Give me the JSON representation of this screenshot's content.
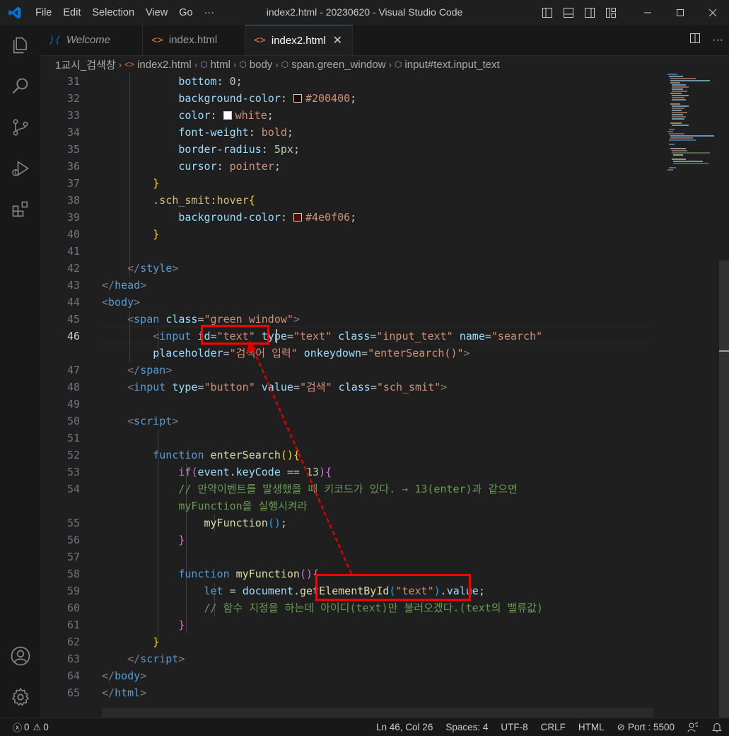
{
  "titlebar": {
    "menu": [
      "File",
      "Edit",
      "Selection",
      "View",
      "Go",
      "···"
    ],
    "title": "index2.html - 20230620 - Visual Studio Code",
    "colors": {
      "vscode_blue": "#0078d4"
    }
  },
  "activity_bar": {
    "items": [
      "files-icon",
      "search-icon",
      "source-control-icon",
      "run-debug-icon",
      "extensions-icon"
    ],
    "bottom": [
      "account-icon",
      "settings-gear-icon"
    ]
  },
  "tabs": [
    {
      "label": "Welcome",
      "icon": "vscode-icon",
      "active": false
    },
    {
      "label": "index.html",
      "icon": "<>",
      "active": false
    },
    {
      "label": "index2.html",
      "icon": "<>",
      "active": true
    }
  ],
  "breadcrumb": [
    "1교시_검색창",
    "index2.html",
    "html",
    "body",
    "span.green_window",
    "input#text.input_text"
  ],
  "editor": {
    "line_numbers": [
      "31",
      "32",
      "33",
      "34",
      "35",
      "36",
      "37",
      "38",
      "39",
      "40",
      "41",
      "42",
      "43",
      "44",
      "45",
      "46",
      "",
      "47",
      "48",
      "49",
      "50",
      "51",
      "52",
      "53",
      "54",
      "",
      "55",
      "56",
      "57",
      "58",
      "59",
      "60",
      "61",
      "62",
      "63",
      "64",
      "65"
    ],
    "current_line": "46"
  },
  "statusbar": {
    "errors": "0",
    "warnings": "0",
    "position": "Ln 46, Col 26",
    "spaces": "Spaces: 4",
    "encoding": "UTF-8",
    "eol": "CRLF",
    "language": "HTML",
    "port": "Port : 5500"
  }
}
